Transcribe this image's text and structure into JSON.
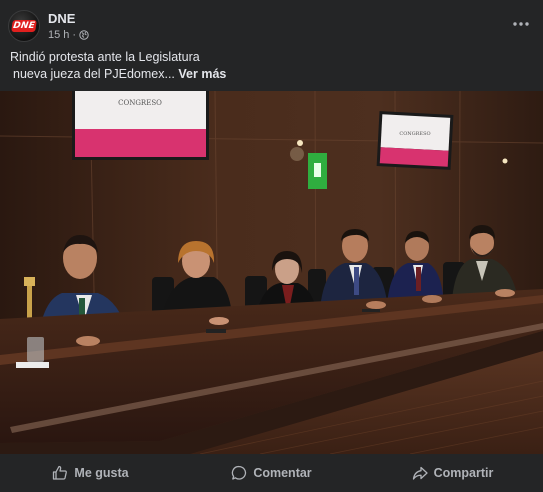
{
  "post": {
    "page_name": "DNE",
    "avatar_logo_text": "DNE",
    "timestamp": "15 h",
    "separator": "·",
    "caption_line1": "Rindió protesta ante la Legislatura",
    "caption_line2": "nueva jueza del PJEdomex...",
    "see_more_label": "Ver más"
  },
  "photo": {
    "screen_left_title": "CONGRESO",
    "screen_right_title": "CONGRESO",
    "exit_sign": "Salida"
  },
  "actions": {
    "like_label": "Me gusta",
    "comment_label": "Comentar",
    "share_label": "Compartir"
  },
  "icons": {
    "more": "more-horizontal-icon",
    "audience": "globe-icon",
    "like": "thumbs-up-icon",
    "comment": "comment-bubble-icon",
    "share": "share-arrow-icon"
  },
  "colors": {
    "background": "#242526",
    "primary_text": "#e4e6eb",
    "secondary_text": "#b0b3b8",
    "brand_red": "#e0201e"
  }
}
